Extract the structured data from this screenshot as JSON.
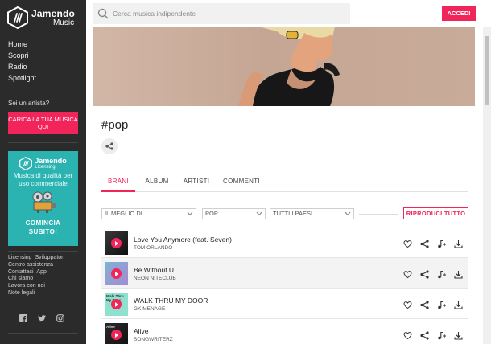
{
  "brand": {
    "name": "Jamendo",
    "sub": "Music"
  },
  "nav": [
    "Home",
    "Scopri",
    "Radio",
    "Spotlight"
  ],
  "artist_question": "Sei un artista?",
  "upload_label": "CARICA LA TUA MUSICA QUI",
  "licensing": {
    "brand": "Jamendo",
    "sub": "Licensing",
    "tagline": "Musica di qualità per uso commerciale",
    "cta_line1": "COMINCIA",
    "cta_line2": "SUBITO!"
  },
  "footer_links": [
    "Licensing",
    "Sviluppatori",
    "Centro assistenza",
    "Contattaci",
    "App",
    "Chi siamo",
    "Lavora con noi",
    "Note legali"
  ],
  "search": {
    "placeholder": "Cerca musica indipendente"
  },
  "login_label": "ACCEDI",
  "page_title": "#pop",
  "tabs": [
    "BRANI",
    "ALBUM",
    "ARTISTI",
    "COMMENTI"
  ],
  "filters": [
    "IL MEGLIO DI",
    "POP",
    "TUTTI I PAESI"
  ],
  "play_all_label": "RIPRODUCI TUTTO",
  "tracks": [
    {
      "title": "Love You Anymore (feat. Seven)",
      "artist": "TOM ORLANDO"
    },
    {
      "title": "Be Without U",
      "artist": "NEON NITECLUB"
    },
    {
      "title": "WALK THRU MY DOOR",
      "artist": "GK MENAGE",
      "cover_text": "Walk Thru My Door"
    },
    {
      "title": "Alive",
      "artist": "SONGWRITERZ",
      "cover_text": "Alive"
    }
  ],
  "colors": {
    "accent": "#f2255b",
    "sidebar": "#2b2b2b",
    "licensing_bg": "#2ab3b1"
  }
}
